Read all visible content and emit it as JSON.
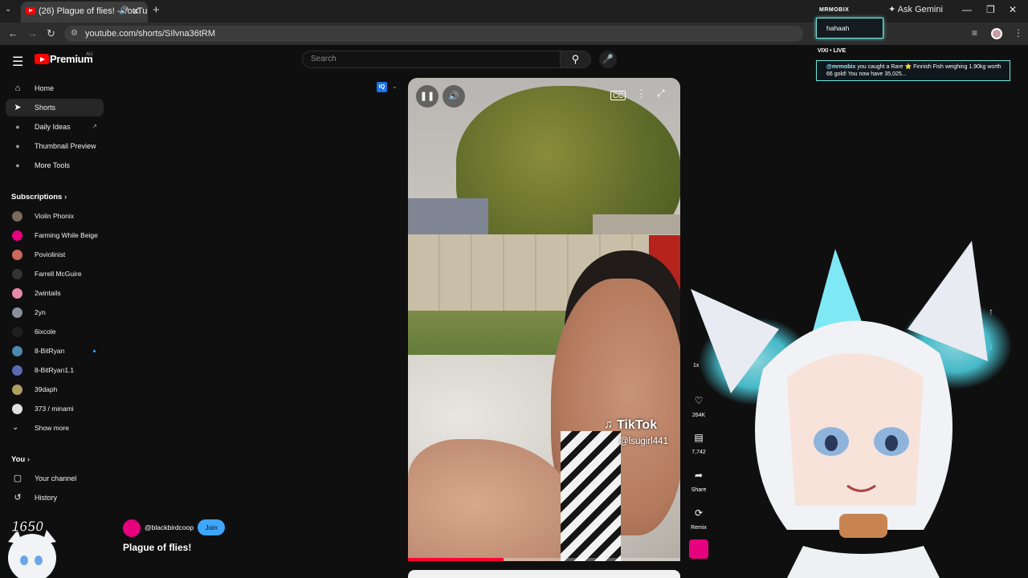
{
  "browser": {
    "tab_title": "(26) Plague of flies! - YouTu",
    "new_tab": "+",
    "ask_gemini": "Ask Gemini",
    "url": "youtube.com/shorts/SIlvna36tRM",
    "controls": {
      "minimize": "—",
      "restore": "❐",
      "close": "✕"
    }
  },
  "youtube": {
    "logo_text": "Premium",
    "country": "AU",
    "search_placeholder": "Search"
  },
  "sidebar": {
    "items": [
      {
        "label": "Home",
        "icon": "home-icon"
      },
      {
        "label": "Shorts",
        "icon": "shorts-icon"
      },
      {
        "label": "Daily Ideas",
        "icon": "tool-icon"
      },
      {
        "label": "Thumbnail Preview",
        "icon": "tool-icon"
      },
      {
        "label": "More Tools",
        "icon": "tool-icon"
      }
    ],
    "subscriptions_heading": "Subscriptions",
    "subscriptions": [
      {
        "label": "Violin Phonix",
        "color": "#7a6a5a"
      },
      {
        "label": "Farming While Beige",
        "color": "#e6007e"
      },
      {
        "label": "Poviolinist",
        "color": "#c96a5a"
      },
      {
        "label": "Farrell McGuire",
        "color": "#333333"
      },
      {
        "label": "2wintails",
        "color": "#e88aa8"
      },
      {
        "label": "2yn",
        "color": "#8a8f9a"
      },
      {
        "label": "6ixcole",
        "color": "#1f1f1f"
      },
      {
        "label": "8-BitRyan",
        "color": "#4a8ab0"
      },
      {
        "label": "8-BitRyan1.1",
        "color": "#5a6ab0"
      },
      {
        "label": "39daph",
        "color": "#b0a060"
      },
      {
        "label": "373 / minami",
        "color": "#e0e0e0"
      }
    ],
    "show_more": "Show more",
    "you_heading": "You",
    "you_items": [
      {
        "label": "Your channel"
      },
      {
        "label": "History"
      }
    ]
  },
  "video": {
    "watermark_brand": "TikTok",
    "watermark_user": "@lsugirl441",
    "progress": 0.35,
    "cc_label": "CC",
    "speed": "1x"
  },
  "actions": {
    "likes": "264K",
    "comments": "7,742",
    "share": "Share",
    "remix": "Remix"
  },
  "channel": {
    "handle": "@blackbirdcoop",
    "join": "Join",
    "title": "Plague of flies!"
  },
  "overlay": {
    "chat_header": "MRMOBIX",
    "chat_message": "hahaah",
    "live_header": "VIXI • LIVE",
    "fish_user": "@mrmobix",
    "fish_text": "you caught a Rare ⭐ Finnish Fish weighing 1.90kg worth 66 gold! You now have 35,025...",
    "cam_number": "1650"
  }
}
